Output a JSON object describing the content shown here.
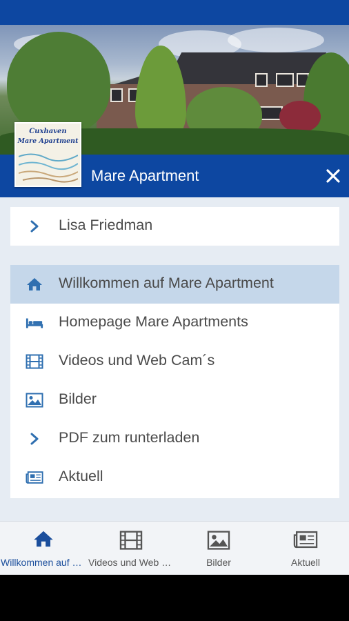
{
  "app": {
    "title": "Mare Apartment",
    "logo_text_line1": "Cuxhaven",
    "logo_text_line2": "Mare Apartment"
  },
  "user": {
    "name": "Lisa Friedman"
  },
  "menu": {
    "items": [
      {
        "label": "Willkommen auf Mare Apartment",
        "icon": "home-icon",
        "active": true
      },
      {
        "label": "Homepage Mare Apartments",
        "icon": "bed-icon",
        "active": false
      },
      {
        "label": "Videos und Web Cam´s",
        "icon": "film-icon",
        "active": false
      },
      {
        "label": "Bilder",
        "icon": "image-icon",
        "active": false
      },
      {
        "label": "PDF zum runterladen",
        "icon": "chevron-right-icon",
        "active": false
      },
      {
        "label": "Aktuell",
        "icon": "newspaper-icon",
        "active": false
      }
    ]
  },
  "bottom_nav": {
    "tabs": [
      {
        "label": "Willkommen auf Mare Apartment",
        "icon": "home-icon",
        "active": true
      },
      {
        "label": "Videos und Web Cam´s",
        "icon": "film-icon",
        "active": false
      },
      {
        "label": "Bilder",
        "icon": "image-icon",
        "active": false
      },
      {
        "label": "Aktuell",
        "icon": "newspaper-icon",
        "active": false
      }
    ]
  },
  "colors": {
    "primary": "#0d47a1",
    "icon_blue": "#2f6fb0",
    "active_row": "#c5d7ea",
    "content_bg": "#e6ecf3"
  }
}
